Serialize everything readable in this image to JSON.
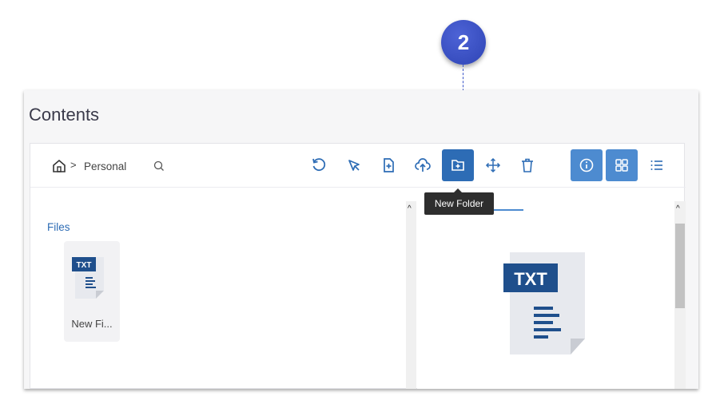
{
  "callout": {
    "number": "2"
  },
  "window": {
    "title": "Contents"
  },
  "breadcrumb": {
    "current": "Personal",
    "separator": ">"
  },
  "toolbar": {
    "buttons": [
      {
        "icon": "refresh-icon"
      },
      {
        "icon": "select-icon"
      },
      {
        "icon": "new-file-icon"
      },
      {
        "icon": "upload-icon"
      },
      {
        "icon": "new-folder-icon",
        "active": true
      },
      {
        "icon": "move-icon"
      },
      {
        "icon": "delete-icon"
      },
      {
        "icon": "info-icon",
        "toggled": true
      },
      {
        "icon": "grid-view-icon",
        "toggled": true
      },
      {
        "icon": "list-view-icon"
      }
    ]
  },
  "tooltip": {
    "text": "New Folder"
  },
  "files": {
    "section_label": "Files",
    "items": [
      {
        "name": "New Fi...",
        "badge": "TXT"
      }
    ]
  },
  "preview": {
    "badge": "TXT"
  },
  "colors": {
    "accent": "#2d6cb5",
    "toggle": "#4d8bd0",
    "callout": "#3c57c9"
  }
}
